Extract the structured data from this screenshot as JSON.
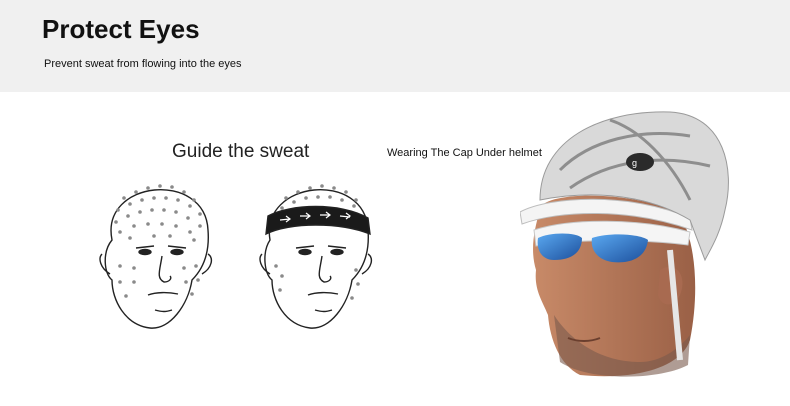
{
  "header": {
    "title": "Protect Eyes",
    "subtitle": "Prevent sweat from flowing into the eyes"
  },
  "illustration": {
    "caption": "Guide the sweat",
    "left_head_icon": "head-with-sweat-drops-icon",
    "right_head_icon": "head-with-sweatband-icon"
  },
  "photo": {
    "caption": "Wearing The Cap Under helmet"
  },
  "colors": {
    "banner_bg": "#f0f0f0",
    "helmet": "#d9d9d9",
    "skin": "#b97c5c",
    "lens": "#2f7fd8"
  }
}
